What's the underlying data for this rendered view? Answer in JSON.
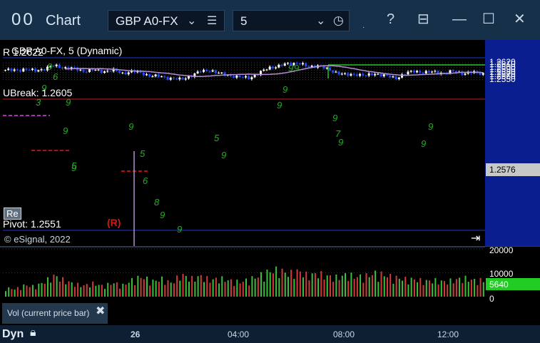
{
  "window": {
    "app_icon": "00",
    "title": "Chart",
    "symbol": "GBP A0-FX",
    "interval": "5",
    "icons": [
      "chevron-down-icon",
      "menu-icon",
      "chevron-down-icon",
      "clock-icon",
      "help-icon",
      "template-icon",
      "minimize-icon",
      "maximize-icon",
      "close-icon"
    ]
  },
  "chart": {
    "header_label": "GBP A0-FX, 5 (Dynamic)",
    "rbreak_label": "R 1.2622",
    "ubreak_label": "UBreak: 1.2605",
    "pivot_label": "Pivot: 1.2551",
    "re_button": "Re",
    "r_marker": "(R)",
    "copyright": "© eSignal, 2022",
    "skip_icon": "skip-to-end-icon",
    "current_price": "1.2576",
    "price_ticks": [
      "1.2620",
      "1.2610",
      "1.2600",
      "1.2590",
      "1.2580",
      "1.2570",
      "1.2560",
      "1.2550"
    ],
    "volume_ticks": [
      "20000",
      "10000",
      "0"
    ],
    "current_volume": "5640",
    "volume_panel_label": "Vol (current price bar)",
    "time_labels": [
      "26",
      "04:00",
      "08:00",
      "12:00"
    ],
    "bottom_label": "Dyn",
    "colors": {
      "up_bar": "#ffffff",
      "down_bar": "#1f4dff",
      "ma_line": "#b48fd6",
      "resistance": "#c81e1e",
      "support": "#1a3ccf",
      "green_line": "#1fc81f",
      "vol_up": "#3dbf3d",
      "vol_down": "#d13b3b",
      "current_price_bg": "#c8c8c8",
      "current_volume_bg": "#22cc22"
    }
  },
  "chart_data": {
    "type": "candlestick",
    "title": "GBP A0-FX, 5 (Dynamic)",
    "ylim": [
      1.2545,
      1.2625
    ],
    "price_levels": {
      "R": 1.2622,
      "UBreak": 1.2605,
      "Pivot": 1.2551,
      "last": 1.2576
    },
    "volume_ylim": [
      0,
      20000
    ],
    "last_volume": 5640,
    "close_path": [
      1.259,
      1.2588,
      1.2594,
      1.2586,
      1.2596,
      1.2608,
      1.26,
      1.2596,
      1.2586,
      1.259,
      1.2584,
      1.259,
      1.2576,
      1.2586,
      1.2576,
      1.2566,
      1.2562,
      1.2556,
      1.255,
      1.2566,
      1.2584,
      1.259,
      1.2574,
      1.2568,
      1.256,
      1.2558,
      1.2576,
      1.26,
      1.2606,
      1.2616,
      1.262,
      1.2602,
      1.261,
      1.2592,
      1.258,
      1.2568,
      1.2574,
      1.2566,
      1.2576,
      1.2566,
      1.2556,
      1.2576,
      1.2586,
      1.258,
      1.2582,
      1.2578,
      1.2584,
      1.2576,
      1.258,
      1.2576
    ],
    "volume_path": [
      3000,
      2600,
      4000,
      3400,
      5200,
      7200,
      5600,
      4400,
      3800,
      4600,
      3600,
      4800,
      3900,
      5800,
      6900,
      5200,
      6100,
      4700,
      7600,
      6100,
      7000,
      5700,
      6300,
      5500,
      5000,
      5900,
      7200,
      8600,
      9300,
      7800,
      8800,
      7200,
      8000,
      7000,
      6600,
      7600,
      6800,
      7100,
      8100,
      7300,
      6500,
      6000,
      5900,
      5300,
      5600,
      5100,
      5700,
      6400,
      5600,
      5640
    ]
  }
}
